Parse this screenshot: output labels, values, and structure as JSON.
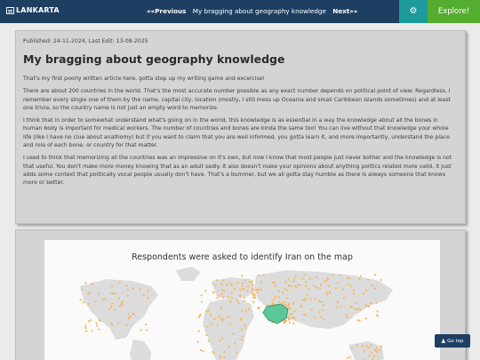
{
  "header": {
    "logo_text": "LANKARTA",
    "prev_label": "««Previous",
    "article_title": "My bragging about geography knowledge",
    "next_label": "Next»»",
    "settings_icon": "gear-icon",
    "explore_label": "Explore!"
  },
  "article": {
    "meta": "Published: 24-11-2024, Last Edit: 13-08-2025",
    "title": "My bragging about geography knowledge",
    "paragraphs": [
      "That's my first poorly written article here, gotta step up my writing game and excercise!",
      "There are about 200 countries in the world. That's the most accurate number possible as any exact number depends on political point of view. Regardless, I remember every single one of them by the name, capital city, location (mostly, I still mess up Oceania and small Caribbean islands sometimes) and at least one trivia, so the country name is not just an empty word to memorize.",
      "I think that in order to somewhat understand what's going on in the world, this knowledge is as essential in a way the knowledge about all the bones in human body is important for medical workers. The number of countries and bones are kinda the same too! You can live without that knowledge your whole life (like I have no clue about anathomy) but if you want to claim that you are well informed, you gotta learn it, and more importantly, understand the place and role of each bone, or country for that matter.",
      "I used to think that memorizing all the countries was an impressive on it's own, but now I know that most people just never bother and the knowledge is not that useful. You don't make more money knowing that as an adult sadly. It also doesn't make your opinions about anything politics related more valid, it just adds some context that politically vocal people usually don't have. That's a bummer, but we all gotta stay humble as there is always someone that knows more or better."
    ]
  },
  "figure": {
    "title": "Respondents were asked to identify Iran on the map",
    "colors": {
      "dots": "#f5b85c",
      "iran": "#5cc79a",
      "land": "#dcdcdc"
    }
  },
  "go_top": {
    "label": "Go top",
    "icon": "arrow-up-icon"
  }
}
